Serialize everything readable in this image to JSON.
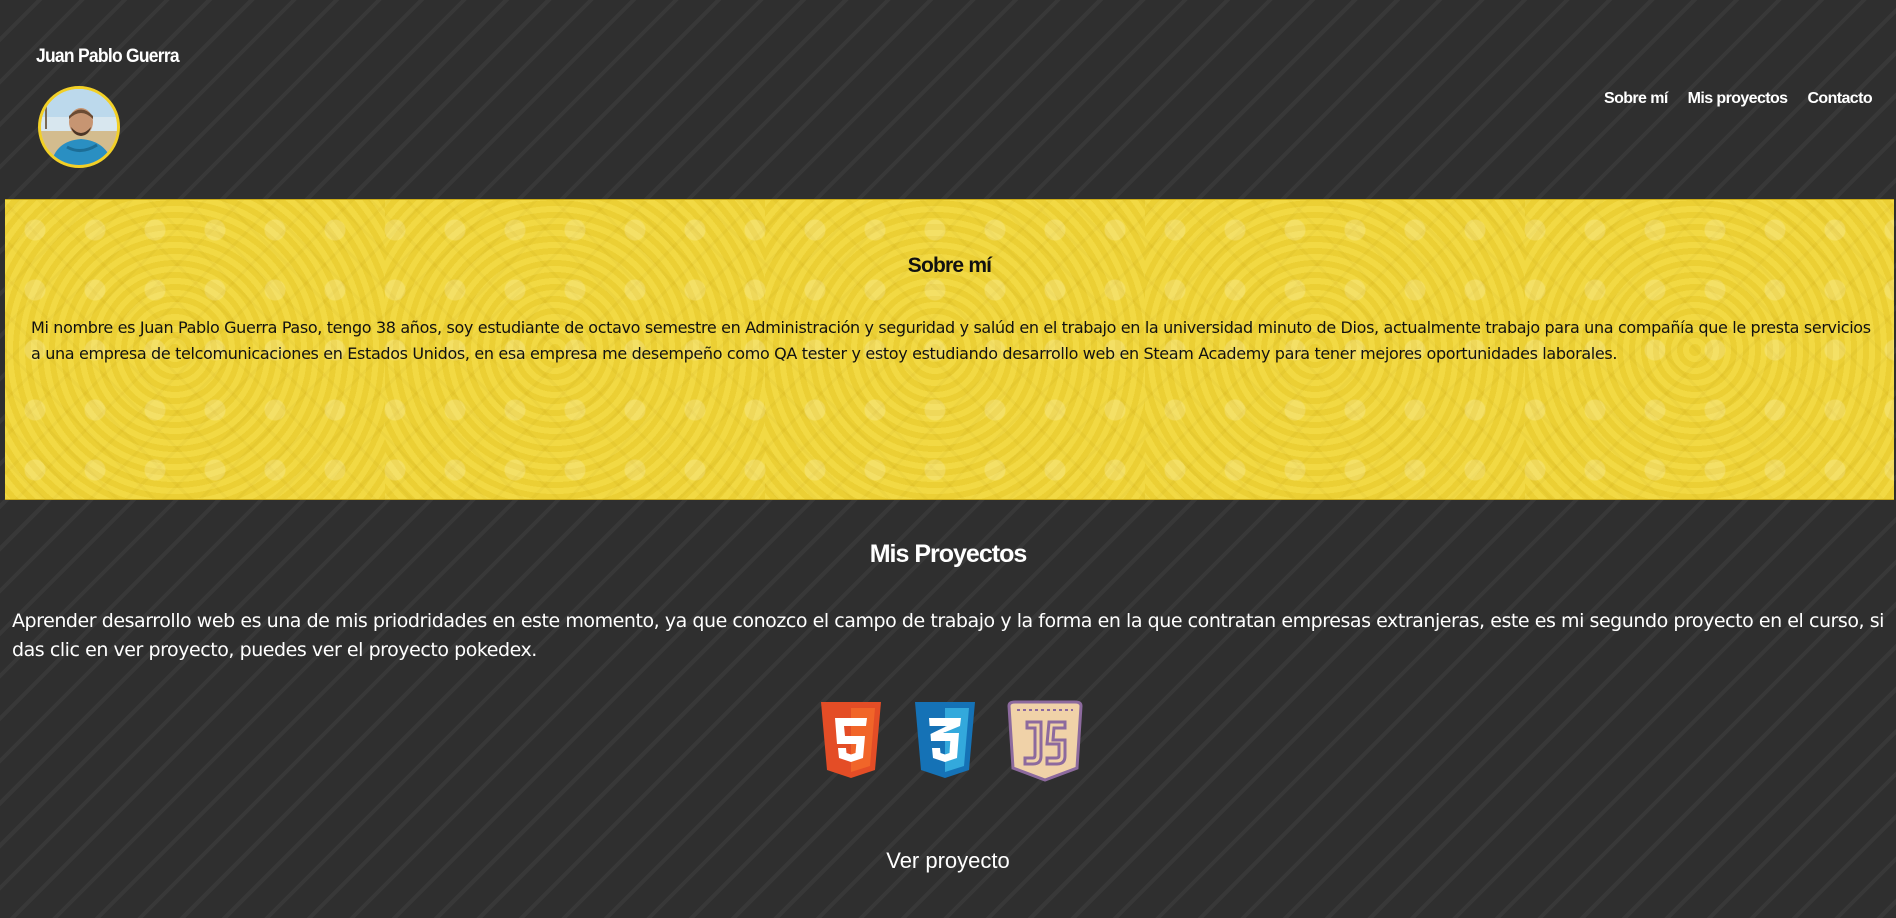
{
  "header": {
    "site_name": "Juan Pablo Guerra",
    "nav": [
      {
        "label": "Sobre mí"
      },
      {
        "label": "Mis proyectos"
      },
      {
        "label": "Contacto"
      }
    ],
    "avatar_icon": "profile-photo"
  },
  "about": {
    "title": "Sobre mí",
    "text": "Mi nombre es Juan Pablo Guerra Paso, tengo 38 años, soy estudiante de octavo semestre en Administración y seguridad y salúd en el trabajo en la universidad minuto de Dios, actualmente trabajo para una compañía que le presta servicios a una empresa de telcomunicaciones en Estados Unidos, en esa empresa me desempeño como QA tester y estoy estudiando desarrollo web en Steam Academy para tener mejores oportunidades laborales."
  },
  "projects": {
    "title": "Mis Proyectos",
    "text": "Aprender desarrollo web es una de mis priodridades en este momento, ya que conozco el campo de trabajo y la forma en la que contratan empresas extranjeras, este es mi segundo proyecto en el curso, si das clic en ver proyecto, puedes ver el proyecto pokedex.",
    "icons": [
      "html5-icon",
      "css3-icon",
      "javascript-icon"
    ],
    "link_label": "Ver proyecto"
  },
  "colors": {
    "background": "#303030",
    "accent_yellow": "#f0d638",
    "html5": "#e44d26",
    "css3": "#1b8fdc",
    "js": "#f0d2a8"
  }
}
